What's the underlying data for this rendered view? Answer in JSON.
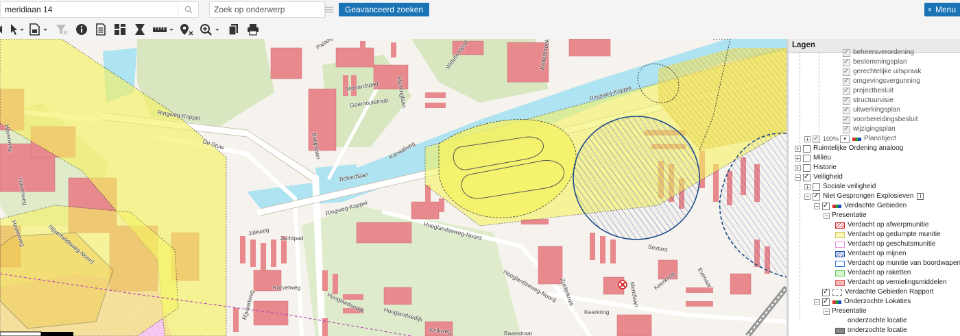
{
  "search": {
    "address_value": "meridiaan 14",
    "subject_placeholder": "Zoek op onderwerp",
    "advanced_label": "Geavanceerd zoeken",
    "menu_label": "Menu"
  },
  "map": {
    "streets": [
      "Paladijnenweg",
      "Monarchpad",
      "Flaminglaan",
      "Wittebindpad",
      "Geernoutstraat",
      "Kattenbroekerweg",
      "Ringweg-Koppel",
      "Ringweg-Koppel",
      "Ringweg-Koppel",
      "De Stuw",
      "Havenweg",
      "Havenweg",
      "Havenweg",
      "Batlijnlaan",
      "Kanaalweg",
      "Bollardlaan",
      "Hooglandseweg-Noord",
      "Hooglandseweg-Noord",
      "Jalkweg",
      "Jachtpad",
      "Korvetweg",
      "Hooglandsedijk",
      "Hooglandsedijk",
      "Nijverheidsweg-Noord",
      "Sextant",
      "Meridiaan",
      "Evenaar",
      "Keerkring",
      "Keerkring",
      "Kelkweg",
      "Zuiderkruis",
      "Rijvaartweg",
      "Baanstraat"
    ],
    "marker": "location-marker-icon",
    "colors": {
      "water": "#aee3f2",
      "green": "#d8e7c0",
      "building": "#e8898e",
      "yellow": "#f5f263",
      "explosive": "#1a4a8a"
    }
  },
  "layers": {
    "title": "Lagen",
    "items": [
      {
        "label": "beheersverordening"
      },
      {
        "label": "bestemmingsplan"
      },
      {
        "label": "gerechtelijke uitspraak"
      },
      {
        "label": "omgevingsvergunning"
      },
      {
        "label": "projectbesluit"
      },
      {
        "label": "structuurvisie"
      },
      {
        "label": "uitwerkingsplan"
      },
      {
        "label": "voorbereidingsbesluit"
      },
      {
        "label": "wijzigingsplan"
      },
      {
        "label": "Planobject",
        "opacity": "100%"
      },
      {
        "label": "Ruimtelijke Ordening analoog"
      },
      {
        "label": "Milieu"
      },
      {
        "label": "Historie"
      },
      {
        "label": "Veiligheid"
      },
      {
        "label": "Sociale veiligheid"
      },
      {
        "label": "Niet Gesprongen Explosieven"
      },
      {
        "label": "Verdachte Gebieden"
      },
      {
        "label": "Presentatie"
      },
      {
        "label": "Verdacht op afwerpmunitie"
      },
      {
        "label": "Verdacht op gedumpte munitie"
      },
      {
        "label": "Verdacht op geschutsmunitie"
      },
      {
        "label": "Verdacht op mijnen"
      },
      {
        "label": "Verdacht op munitie van boordwapens"
      },
      {
        "label": "Verdacht op raketten"
      },
      {
        "label": "Verdacht op vernielingsmiddelen"
      },
      {
        "label": "Verdachte Gebieden Rapport"
      },
      {
        "label": "Onderzochte Lokaties"
      },
      {
        "label": "Presentatie"
      },
      {
        "label": "onderzochte locatie"
      },
      {
        "label": "onderzochte locatie"
      }
    ]
  }
}
